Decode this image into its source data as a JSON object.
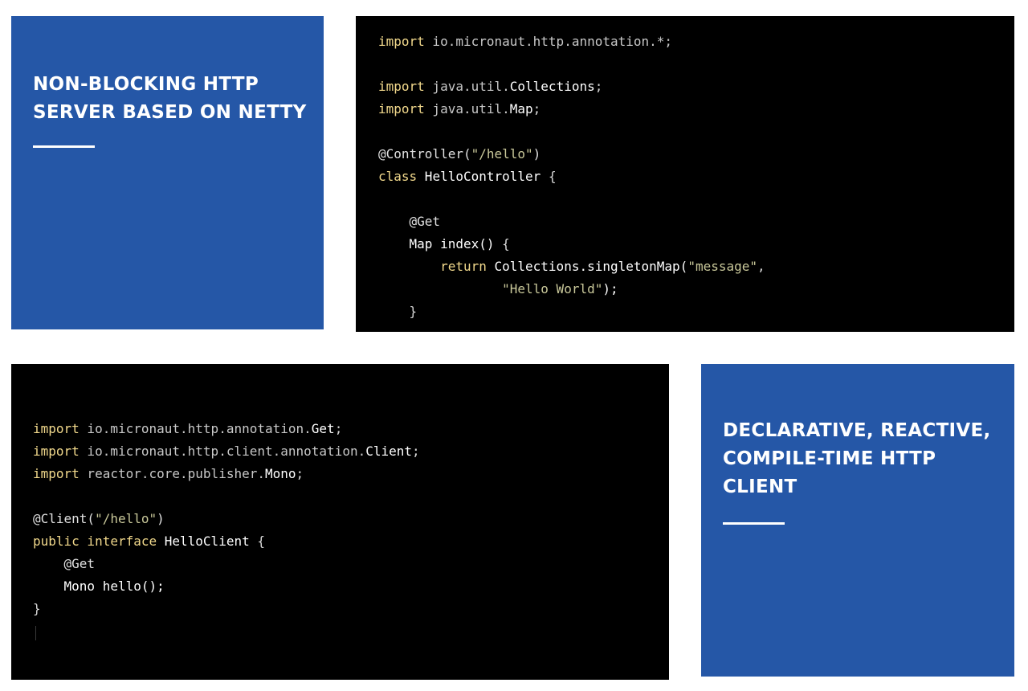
{
  "features": [
    {
      "title": "NON-BLOCKING HTTP\nSERVER BASED ON NETTY"
    },
    {
      "title": "DECLARATIVE, REACTIVE,\nCOMPILE-TIME HTTP\nCLIENT"
    }
  ],
  "code_blocks": [
    {
      "lines": [
        [
          [
            "kw",
            "import"
          ],
          [
            "pkg",
            " io.micronaut.http.annotation.*;"
          ]
        ],
        [],
        [
          [
            "kw",
            "import"
          ],
          [
            "pkg",
            " java.util."
          ],
          [
            "id",
            "Collections"
          ],
          [
            "pun",
            ";"
          ]
        ],
        [
          [
            "kw",
            "import"
          ],
          [
            "pkg",
            " java.util."
          ],
          [
            "id",
            "Map"
          ],
          [
            "pun",
            ";"
          ]
        ],
        [],
        [
          [
            "ann",
            "@Controller("
          ],
          [
            "str",
            "\"/hello\""
          ],
          [
            "ann",
            ")"
          ]
        ],
        [
          [
            "kw",
            "class"
          ],
          [
            "id",
            " HelloController "
          ],
          [
            "pun",
            "{"
          ]
        ],
        [],
        [
          [
            "ann",
            "    @Get"
          ]
        ],
        [
          [
            "id",
            "    Map index() "
          ],
          [
            "pun",
            "{"
          ]
        ],
        [
          [
            "kw",
            "        return"
          ],
          [
            "id",
            " Collections.singletonMap("
          ],
          [
            "str",
            "\"message\""
          ],
          [
            "pun",
            ","
          ]
        ],
        [
          [
            "str",
            "                \"Hello World\""
          ],
          [
            "id",
            ");"
          ]
        ],
        [
          [
            "pun",
            "    }"
          ]
        ]
      ]
    },
    {
      "lines": [
        [
          [
            "kw",
            "import"
          ],
          [
            "pkg",
            " io.micronaut.http.annotation."
          ],
          [
            "id",
            "Get"
          ],
          [
            "pun",
            ";"
          ]
        ],
        [
          [
            "kw",
            "import"
          ],
          [
            "pkg",
            " io.micronaut.http.client.annotation."
          ],
          [
            "id",
            "Client"
          ],
          [
            "pun",
            ";"
          ]
        ],
        [
          [
            "kw",
            "import"
          ],
          [
            "pkg",
            " reactor.core.publisher."
          ],
          [
            "id",
            "Mono"
          ],
          [
            "pun",
            ";"
          ]
        ],
        [],
        [
          [
            "ann",
            "@Client("
          ],
          [
            "str",
            "\"/hello\""
          ],
          [
            "ann",
            ")"
          ]
        ],
        [
          [
            "kw",
            "public interface"
          ],
          [
            "id",
            " HelloClient "
          ],
          [
            "pun",
            "{"
          ]
        ],
        [
          [
            "ann",
            "    @Get"
          ]
        ],
        [
          [
            "id",
            "    Mono hello();"
          ]
        ],
        [
          [
            "pun",
            "}"
          ]
        ]
      ]
    }
  ]
}
